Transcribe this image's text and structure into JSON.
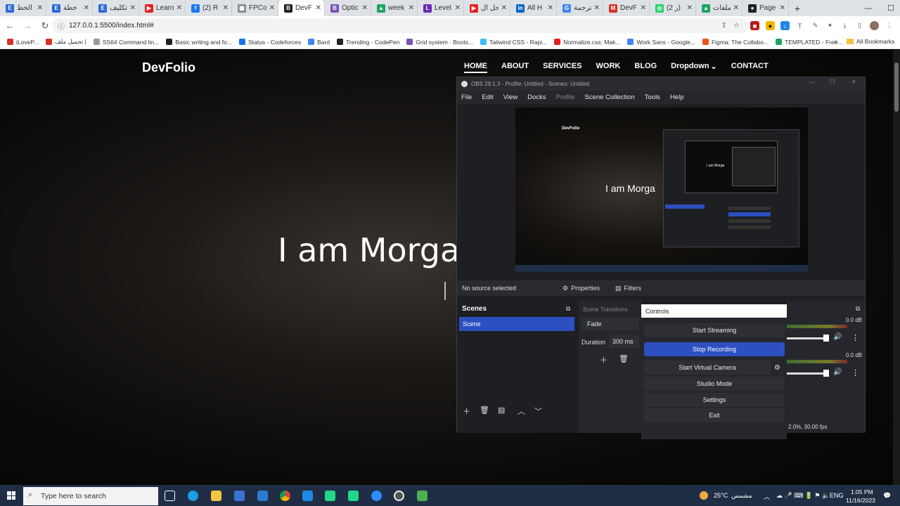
{
  "browser": {
    "tabs": [
      {
        "label": "الخط",
        "color": "#2a6ad6",
        "glyph": "E"
      },
      {
        "label": "خطة",
        "color": "#2a6ad6",
        "glyph": "E"
      },
      {
        "label": "تكليف",
        "color": "#2a6ad6",
        "glyph": "E"
      },
      {
        "label": "Learn",
        "color": "#e3221e",
        "glyph": "▶"
      },
      {
        "label": "(2) R",
        "color": "#1877f2",
        "glyph": "f"
      },
      {
        "label": "FPCo",
        "color": "#888888",
        "glyph": "▦"
      },
      {
        "label": "DevF",
        "color": "#222222",
        "glyph": "B"
      },
      {
        "label": "Optic",
        "color": "#7952b3",
        "glyph": "B"
      },
      {
        "label": "week",
        "color": "#1fa463",
        "glyph": "▲"
      },
      {
        "label": "Level",
        "color": "#6a2bb2",
        "glyph": "L"
      },
      {
        "label": "حل ال",
        "color": "#e3221e",
        "glyph": "▶"
      },
      {
        "label": "All H",
        "color": "#0a66c2",
        "glyph": "in"
      },
      {
        "label": "ترجمة",
        "color": "#4285f4",
        "glyph": "G"
      },
      {
        "label": "DevF",
        "color": "#d93025",
        "glyph": "M"
      },
      {
        "label": "(2 ر)",
        "color": "#25d366",
        "glyph": "◎"
      },
      {
        "label": "ملفات",
        "color": "#1fa463",
        "glyph": "▲"
      },
      {
        "label": "Page",
        "color": "#222222",
        "glyph": "●"
      }
    ],
    "active_tab_index": 6,
    "url": "127.0.0.1:5500/index.html#",
    "bookmarks": [
      {
        "label": "iLoveP...",
        "color": "#d93025"
      },
      {
        "label": "تحميل ملف |",
        "color": "#d93025"
      },
      {
        "label": "SS64 Command lin...",
        "color": "#999999"
      },
      {
        "label": "Basic writing and fo...",
        "color": "#222222"
      },
      {
        "label": "Status - Codeforces",
        "color": "#1a73e8"
      },
      {
        "label": "Bard",
        "color": "#4285f4"
      },
      {
        "label": "Trending - CodePen",
        "color": "#222222"
      },
      {
        "label": "Grid system · Boots...",
        "color": "#7952b3"
      },
      {
        "label": "Tailwind CSS - Rapi...",
        "color": "#38bdf8"
      },
      {
        "label": "Normalize.css: Mak...",
        "color": "#e3221e"
      },
      {
        "label": "Work Sans - Google...",
        "color": "#4285f4"
      },
      {
        "label": "Figma: The Collabo...",
        "color": "#f24e1e"
      },
      {
        "label": "TEMPLATED - Free...",
        "color": "#1fa463"
      }
    ],
    "all_bookmarks": "All Bookmarks"
  },
  "site": {
    "brand": "DevFolio",
    "nav": [
      "HOME",
      "ABOUT",
      "SERVICES",
      "WORK",
      "BLOG",
      "Dropdown",
      "CONTACT"
    ],
    "hero": "I am Morga"
  },
  "obs": {
    "title": "OBS 29.1.3 - Profile: Untitled - Scenes: Untitled",
    "menu": [
      "File",
      "Edit",
      "View",
      "Docks",
      "Profile",
      "Scene Collection",
      "Tools",
      "Help"
    ],
    "preview_text": "I am Morga",
    "preview_brand": "DevFolio",
    "no_source": "No source selected",
    "properties": "Properties",
    "filters": "Filters",
    "scenes_header": "Scenes",
    "scene_item": "Scene",
    "transitions_header": "Scene Transitions",
    "transition": "Fade",
    "duration_label": "Duration",
    "duration_value": "300 ms",
    "controls_header": "Controls",
    "controls": [
      "Start Streaming",
      "Stop Recording",
      "Start Virtual Camera",
      "Studio Mode",
      "Settings",
      "Exit"
    ],
    "active_control_index": 1,
    "db1": "0.0 dB",
    "db2": "0.0 dB",
    "status": "2.0%, 30.00 fps",
    "accent": "#2d4fc2"
  },
  "taskbar": {
    "search_placeholder": "Type here to search",
    "weather": "25°C",
    "weather_desc": "مشمس",
    "lang": "ENG",
    "time": "1:05 PM",
    "date": "11/16/2023"
  }
}
